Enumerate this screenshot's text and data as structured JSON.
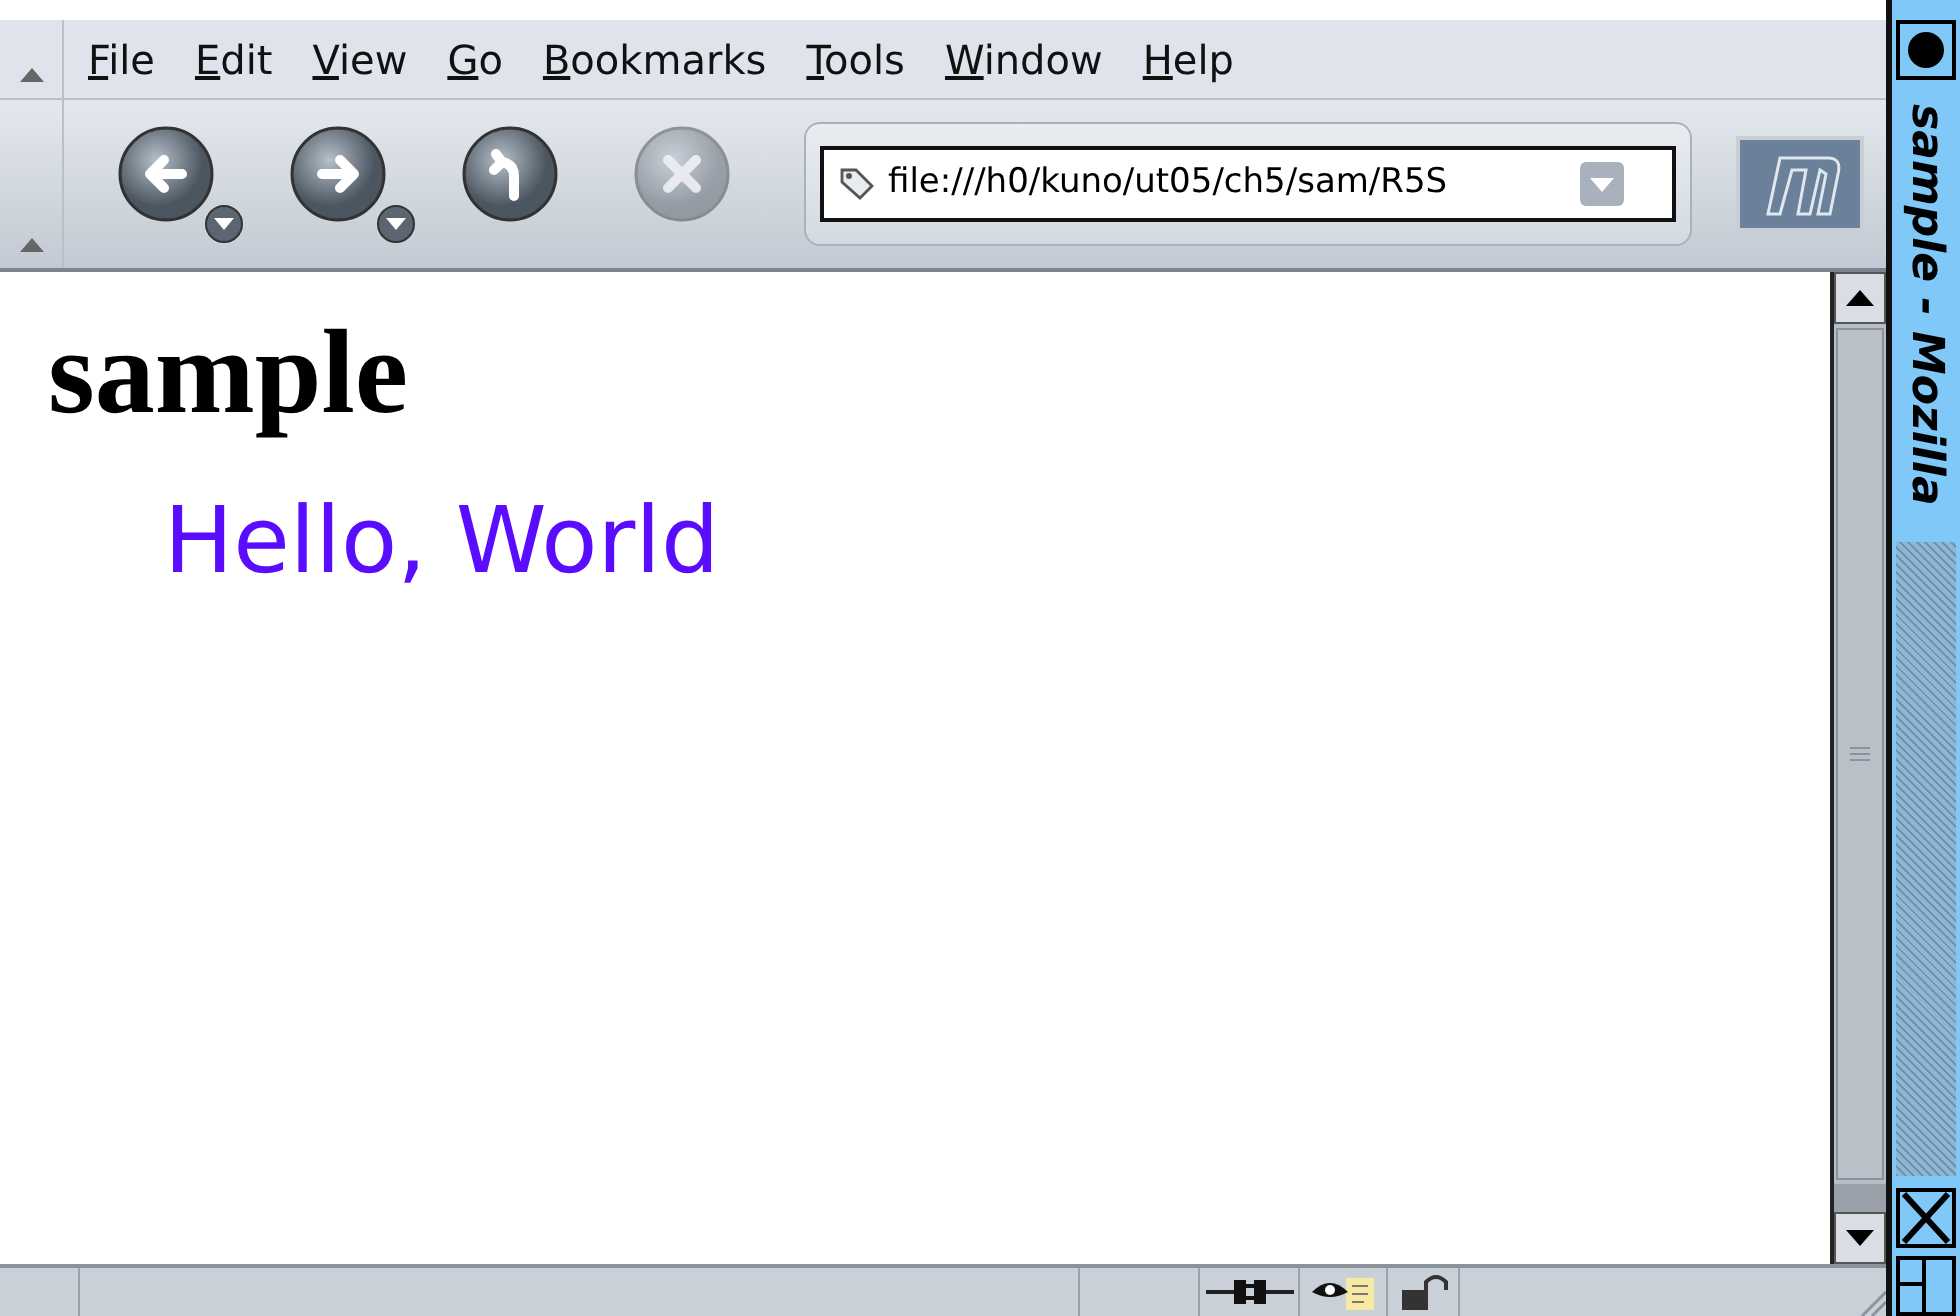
{
  "menu": [
    {
      "label": "File"
    },
    {
      "label": "Edit"
    },
    {
      "label": "View"
    },
    {
      "label": "Go"
    },
    {
      "label": "Bookmarks"
    },
    {
      "label": "Tools"
    },
    {
      "label": "Window"
    },
    {
      "label": "Help"
    }
  ],
  "toolbar": [
    {
      "kind": "back",
      "disabled": false
    },
    {
      "kind": "forward",
      "disabled": false
    },
    {
      "kind": "reload",
      "disabled": false
    },
    {
      "kind": "stop",
      "disabled": true
    }
  ],
  "address": {
    "value": "file:///h0/kuno/ut05/ch5/sam/R5S"
  },
  "page": {
    "heading": "sample",
    "text": "Hello, World"
  },
  "window_title": "sample - Mozilla"
}
